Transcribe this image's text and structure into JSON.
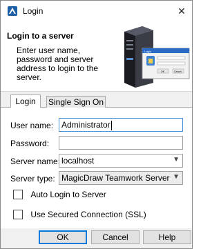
{
  "window": {
    "title": "Login",
    "close_glyph": "✕",
    "app_icon": "magicdraw-app-icon"
  },
  "banner": {
    "title": "Login to a server",
    "text": "Enter user name, password and server address to login to the server.",
    "illustration": {
      "dialog_title": "Login",
      "ok_label": "OK",
      "cancel_label": "Cancel"
    }
  },
  "tabs": [
    {
      "label": "Login",
      "active": true
    },
    {
      "label": "Single Sign On",
      "active": false
    }
  ],
  "form": {
    "user_name": {
      "label": "User name:",
      "value": "Administrator"
    },
    "password": {
      "label": "Password:",
      "value": ""
    },
    "server_name": {
      "label": "Server name:",
      "value": "localhost"
    },
    "server_type": {
      "label": "Server type:",
      "value": "MagicDraw Teamwork Server"
    },
    "auto_login": {
      "label": "Auto Login to Server",
      "checked": false
    },
    "ssl": {
      "label": "Use Secured Connection (SSL)",
      "checked": false
    }
  },
  "buttons": {
    "ok": "OK",
    "cancel": "Cancel",
    "help": "Help"
  }
}
